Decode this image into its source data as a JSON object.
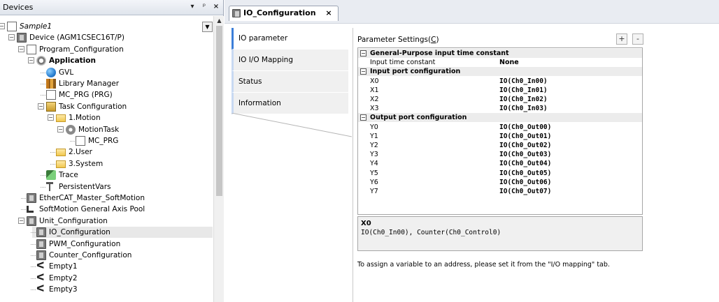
{
  "devices_panel": {
    "title": "Devices",
    "header_buttons": [
      "▾",
      "ᵖ",
      "×"
    ],
    "tree": [
      {
        "label": "Sample1",
        "icon": "project-icon",
        "italic": true,
        "expander": "−"
      },
      {
        "label": "Device (AGM1CSEC16T/P)",
        "icon": "device-icon",
        "expander": "−"
      },
      {
        "label": "Program_Configuration",
        "icon": "program-config-icon",
        "expander": "−"
      },
      {
        "label": "Application",
        "icon": "application-icon",
        "bold": true,
        "expander": "−"
      },
      {
        "label": "GVL",
        "icon": "globe-icon"
      },
      {
        "label": "Library Manager",
        "icon": "library-icon"
      },
      {
        "label": "MC_PRG (PRG)",
        "icon": "document-icon"
      },
      {
        "label": "Task Configuration",
        "icon": "task-icon",
        "expander": "−"
      },
      {
        "label": "1.Motion",
        "icon": "folder-icon",
        "expander": "−"
      },
      {
        "label": "MotionTask",
        "icon": "motion-icon",
        "expander": "−"
      },
      {
        "label": "MC_PRG",
        "icon": "program-call-icon"
      },
      {
        "label": "2.User",
        "icon": "folder-icon"
      },
      {
        "label": "3.System",
        "icon": "folder-icon"
      },
      {
        "label": "Trace",
        "icon": "trace-icon"
      },
      {
        "label": "PersistentVars",
        "icon": "persistent-icon"
      },
      {
        "label": "EtherCAT_Master_SoftMotion",
        "icon": "device-icon"
      },
      {
        "label": "SoftMotion General Axis Pool",
        "icon": "axis-icon"
      },
      {
        "label": "Unit_Configuration",
        "icon": "device-icon",
        "expander": "−"
      },
      {
        "label": "IO_Configuration",
        "icon": "device-icon",
        "selected": true
      },
      {
        "label": "PWM_Configuration",
        "icon": "device-icon"
      },
      {
        "label": "Counter_Configuration",
        "icon": "device-icon"
      },
      {
        "label": "Empty1",
        "icon": "empty-slot-icon"
      },
      {
        "label": "Empty2",
        "icon": "empty-slot-icon"
      },
      {
        "label": "Empty3",
        "icon": "empty-slot-icon"
      }
    ]
  },
  "editor": {
    "tab_label": "IO_Configuration",
    "tab_close": "×",
    "side_tabs": [
      "IO parameter",
      "IO I/O Mapping",
      "Status",
      "Information"
    ],
    "param_label": "Parameter Settings(C)",
    "param_label_mnemonic": "C",
    "plus_label": "+",
    "minus_label": "-",
    "groups": [
      {
        "name": "General-Purpose input time constant",
        "toggle": "−",
        "rows": [
          {
            "name": "Input time constant",
            "value": "None",
            "plain": true
          }
        ]
      },
      {
        "name": "Input port configuration",
        "toggle": "−",
        "rows": [
          {
            "name": "X0",
            "value": "IO(Ch0_In00)"
          },
          {
            "name": "X1",
            "value": "IO(Ch0_In01)"
          },
          {
            "name": "X2",
            "value": "IO(Ch0_In02)"
          },
          {
            "name": "X3",
            "value": "IO(Ch0_In03)"
          }
        ]
      },
      {
        "name": "Output port configuration",
        "toggle": "−",
        "rows": [
          {
            "name": "Y0",
            "value": "IO(Ch0_Out00)"
          },
          {
            "name": "Y1",
            "value": "IO(Ch0_Out01)"
          },
          {
            "name": "Y2",
            "value": "IO(Ch0_Out02)"
          },
          {
            "name": "Y3",
            "value": "IO(Ch0_Out03)"
          },
          {
            "name": "Y4",
            "value": "IO(Ch0_Out04)"
          },
          {
            "name": "Y5",
            "value": "IO(Ch0_Out05)"
          },
          {
            "name": "Y6",
            "value": "IO(Ch0_Out06)"
          },
          {
            "name": "Y7",
            "value": "IO(Ch0_Out07)"
          }
        ]
      }
    ],
    "detail_title": "X0",
    "detail_text": "IO(Ch0_In00), Counter(Ch0_Control0)",
    "assign_note": "To assign a variable to an address, please set it from the \"I/O mapping\" tab."
  },
  "colors": {
    "active_tab_accent": "#3c7fd9",
    "selected_row": "#e8e8e8",
    "group_row": "#ececec"
  }
}
